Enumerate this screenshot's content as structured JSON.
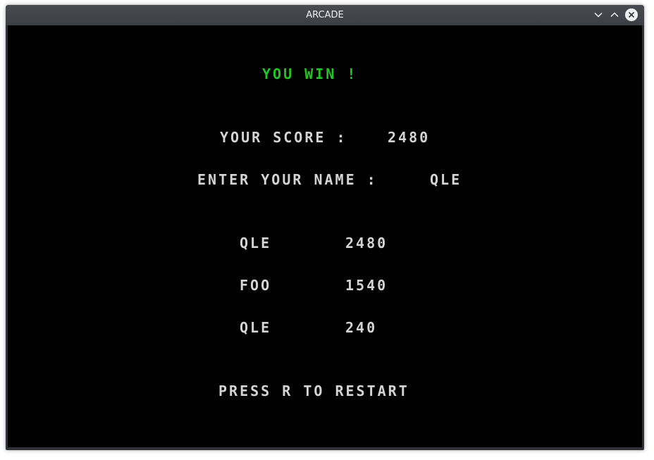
{
  "window": {
    "title": "ARCADE"
  },
  "colors": {
    "win_text": "#22c522",
    "text": "#d4d4d4",
    "background": "#000000"
  },
  "game": {
    "win_message": "YOU WIN !",
    "score_label": "YOUR SCORE :",
    "score_value": "2480",
    "name_label": "ENTER YOUR NAME :",
    "name_value": "QLE",
    "highscores": [
      {
        "name": "QLE",
        "score": "2480"
      },
      {
        "name": "FOO",
        "score": "1540"
      },
      {
        "name": "QLE",
        "score": "240"
      }
    ],
    "restart_hint": "PRESS R TO RESTART"
  }
}
